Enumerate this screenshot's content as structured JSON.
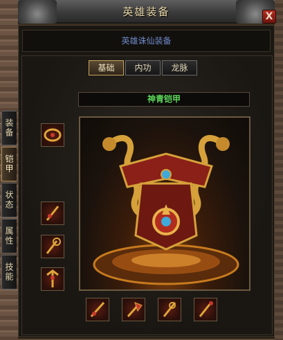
{
  "window": {
    "title": "英雄装备",
    "close_label": "X",
    "subtitle": "英雄诛仙装备"
  },
  "tabs": [
    {
      "label": "基础",
      "active": true
    },
    {
      "label": "内功",
      "active": false
    },
    {
      "label": "龙脉",
      "active": false
    }
  ],
  "side_tabs": [
    {
      "label": "装备",
      "active": false
    },
    {
      "label": "铠甲",
      "active": true
    },
    {
      "label": "状态",
      "active": false
    },
    {
      "label": "属性",
      "active": false
    },
    {
      "label": "技能",
      "active": false
    }
  ],
  "item": {
    "name": "神青铠甲",
    "name_color": "#5bd85a"
  },
  "slots": {
    "left": [
      "belt-icon",
      "sword-icon",
      "wand-icon",
      "trident-icon"
    ],
    "bottom": [
      "sword-icon",
      "axe-icon",
      "blade-icon",
      "staff-icon"
    ]
  }
}
